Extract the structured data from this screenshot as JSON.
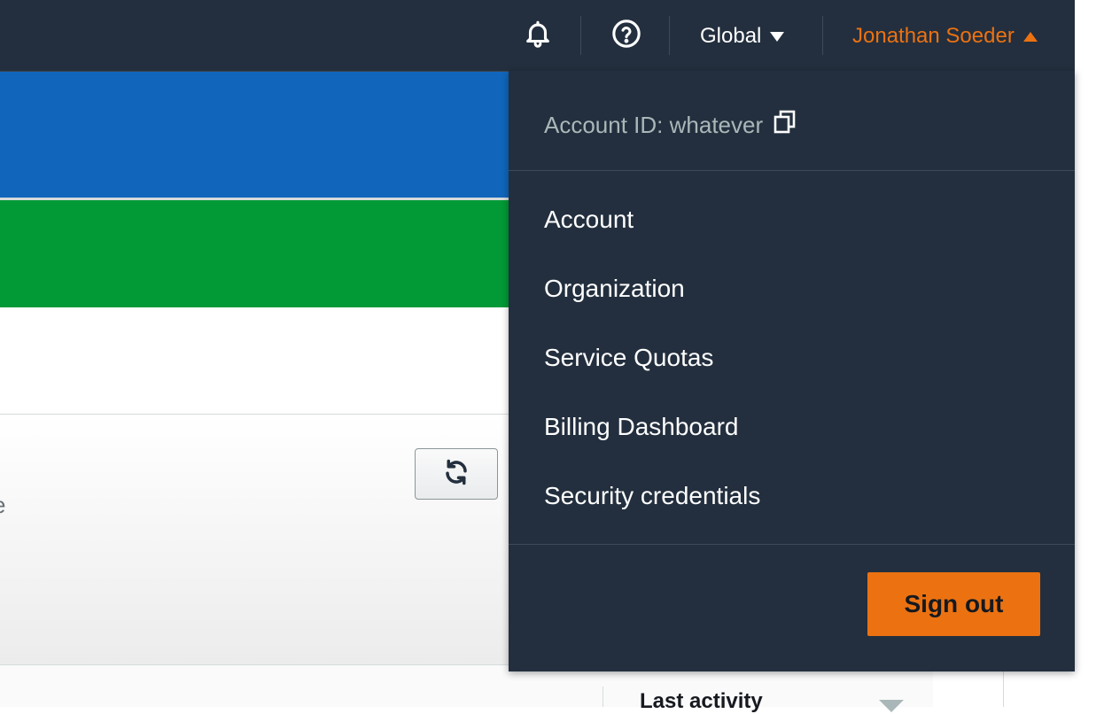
{
  "header": {
    "notifications_icon": "bell-icon",
    "help_icon": "help-circle-icon",
    "region_label": "Global",
    "user_name": "Jonathan Soeder"
  },
  "content": {
    "truncated_text": "e",
    "refresh_icon": "refresh-icon",
    "table_column_header": "Last activity",
    "colors": {
      "banner_blue": "#1166bb",
      "banner_green": "#029a36"
    }
  },
  "user_menu": {
    "account_id": "Account ID: whatever",
    "copy_icon": "copy-icon",
    "items": [
      {
        "label": "Account"
      },
      {
        "label": "Organization"
      },
      {
        "label": "Service Quotas"
      },
      {
        "label": "Billing Dashboard"
      },
      {
        "label": "Security credentials"
      }
    ],
    "sign_out_label": "Sign out"
  },
  "theme": {
    "navbar_bg": "#232f3e",
    "accent_orange": "#ec7211"
  }
}
